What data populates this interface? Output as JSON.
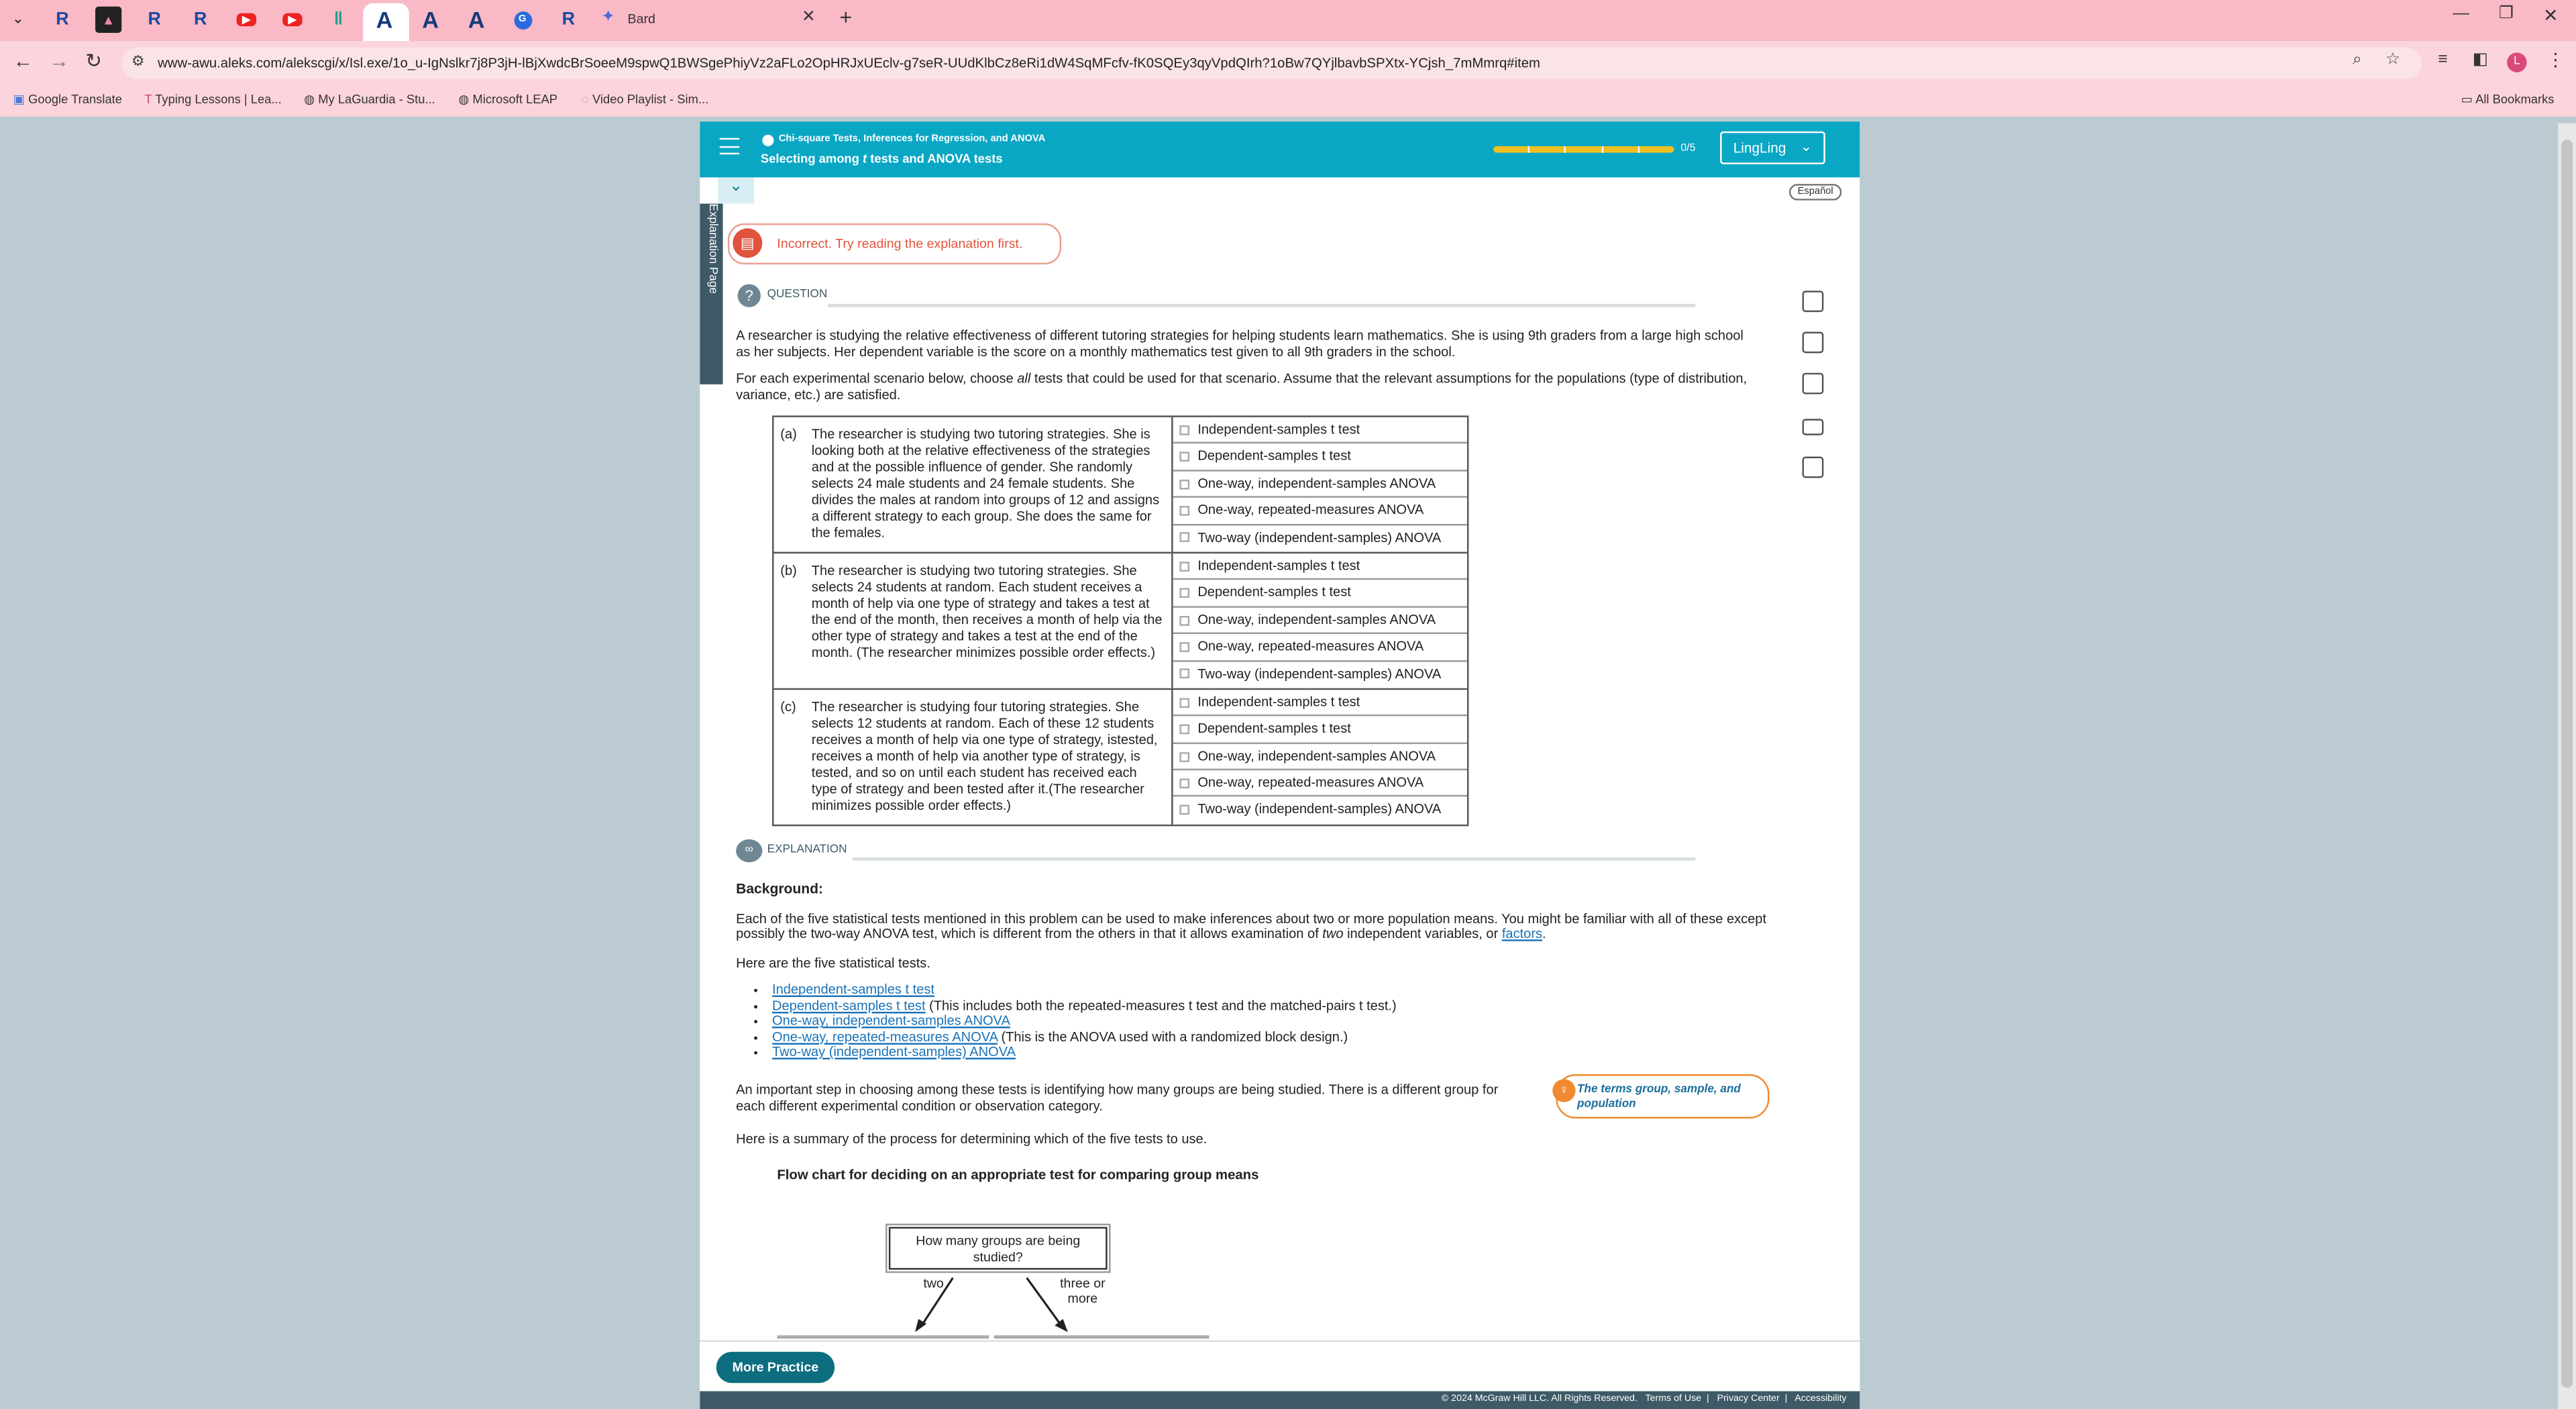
{
  "browser": {
    "tabs": [
      "Bard"
    ],
    "url": "www-awu.aleks.com/alekscgi/x/Isl.exe/1o_u-IgNslkr7j8P3jH-lBjXwdcBrSoeeM9spwQ1BWSgePhiyVz2aFLo2OpHRJxUEclv-g7seR-UUdKlbCz8eRi1dW4SqMFcfv-fK0SQEy3qyVpdQIrh?1oBw7QYjlbavbSPXtx-YCjsh_7mMmrq#item",
    "profile_initial": "L",
    "bookmarks": [
      "Google Translate",
      "Typing Lessons | Lea...",
      "My LaGuardia - Stu...",
      "Microsoft LEAP",
      "Video Playlist - Sim..."
    ],
    "all_bookmarks": "All Bookmarks"
  },
  "aleks": {
    "topic": "Chi-square Tests, Inferences for Regression, and ANOVA",
    "title": "Selecting among t tests and ANOVA tests",
    "progress": "0/5",
    "user": "LingLing",
    "espanol": "Español",
    "side_tab": "Explanation Page",
    "feedback": "Incorrect. Try reading the explanation first.",
    "question_header": "QUESTION",
    "q_p1": "A researcher is studying the relative effectiveness of different tutoring strategies for helping students learn mathematics. She is using 9th graders from a large high school as her subjects. Her dependent variable is the score on a monthly mathematics test given to all 9th graders in the school.",
    "q_p2a": "For each experimental scenario below, choose ",
    "q_p2b": "all",
    "q_p2c": " tests that could be used for that scenario. Assume that the relevant assumptions for the populations (type of distribution, variance, etc.) are satisfied.",
    "options": [
      "Independent-samples t test",
      "Dependent-samples t test",
      "One-way, independent-samples ANOVA",
      "One-way, repeated-measures ANOVA",
      "Two-way (independent-samples) ANOVA"
    ],
    "scenarios": [
      {
        "label": "(a)",
        "text": "The researcher is studying two tutoring strategies. She is looking both at the relative effectiveness of the strategies and at the possible influence of gender. She randomly selects 24 male students and 24 female students. She divides the males at random into groups of 12 and assigns a different strategy to each group. She does the same for the females."
      },
      {
        "label": "(b)",
        "text": "The researcher is studying two tutoring strategies. She selects 24 students at random. Each student receives a month of help via one type of strategy and takes a test at the end of the month, then receives a month of help via the other type of strategy and takes a test at the end of the month. (The researcher minimizes possible order effects.)"
      },
      {
        "label": "(c)",
        "text": "The researcher is studying four tutoring strategies. She selects 12 students at random. Each of these 12 students receives a month of help via one type of strategy, istested, receives a month of help via another type of strategy, is tested, and so on until each student has received each type of strategy and been tested after it.(The researcher minimizes possible order effects.)"
      }
    ],
    "explanation_header": "EXPLANATION",
    "background": "Background:",
    "bg_p1a": "Each of the five statistical tests mentioned in this problem can be used to make inferences about two or more population means. You might be familiar with all of these except possibly the two-way ANOVA test, which is different from the others in that it allows examination of ",
    "bg_p1b": "two",
    "bg_p1c": " independent variables, or ",
    "bg_p1d": "factors",
    "bg_p1e": ".",
    "bg_p2": "Here are the five statistical tests.",
    "tests": [
      {
        "link": "Independent-samples t test",
        "note": ""
      },
      {
        "link": "Dependent-samples t test",
        "note": " (This includes both the repeated-measures t test and the matched-pairs t test.)"
      },
      {
        "link": "One-way, independent-samples ANOVA",
        "note": ""
      },
      {
        "link": "One-way, repeated-measures ANOVA",
        "note": " (This is the ANOVA used with a randomized block design.)"
      },
      {
        "link": "Two-way (independent-samples) ANOVA",
        "note": ""
      }
    ],
    "bg_p3": "An important step in choosing among these tests is identifying how many groups are being studied. There is a different group for each different experimental condition or observation category.",
    "tip": "The terms group, sample, and population",
    "bg_p4": "Here is a summary of the process for determining which of the five tests to use.",
    "flow_title": "Flow chart for deciding on an appropriate test for comparing group means",
    "flow_q": "How many groups are being studied?",
    "flow_two": "two",
    "flow_three": "three or more",
    "more_practice": "More Practice",
    "footer": [
      "© 2024 McGraw Hill LLC. All Rights Reserved.",
      "Terms of Use",
      "Privacy Center",
      "Accessibility"
    ]
  },
  "colors": {
    "chrome": "#f9b9c6",
    "teal": "#0aa7c4",
    "dark": "#3e5a66",
    "accent": "#e0533c",
    "link": "#1a73b8"
  }
}
